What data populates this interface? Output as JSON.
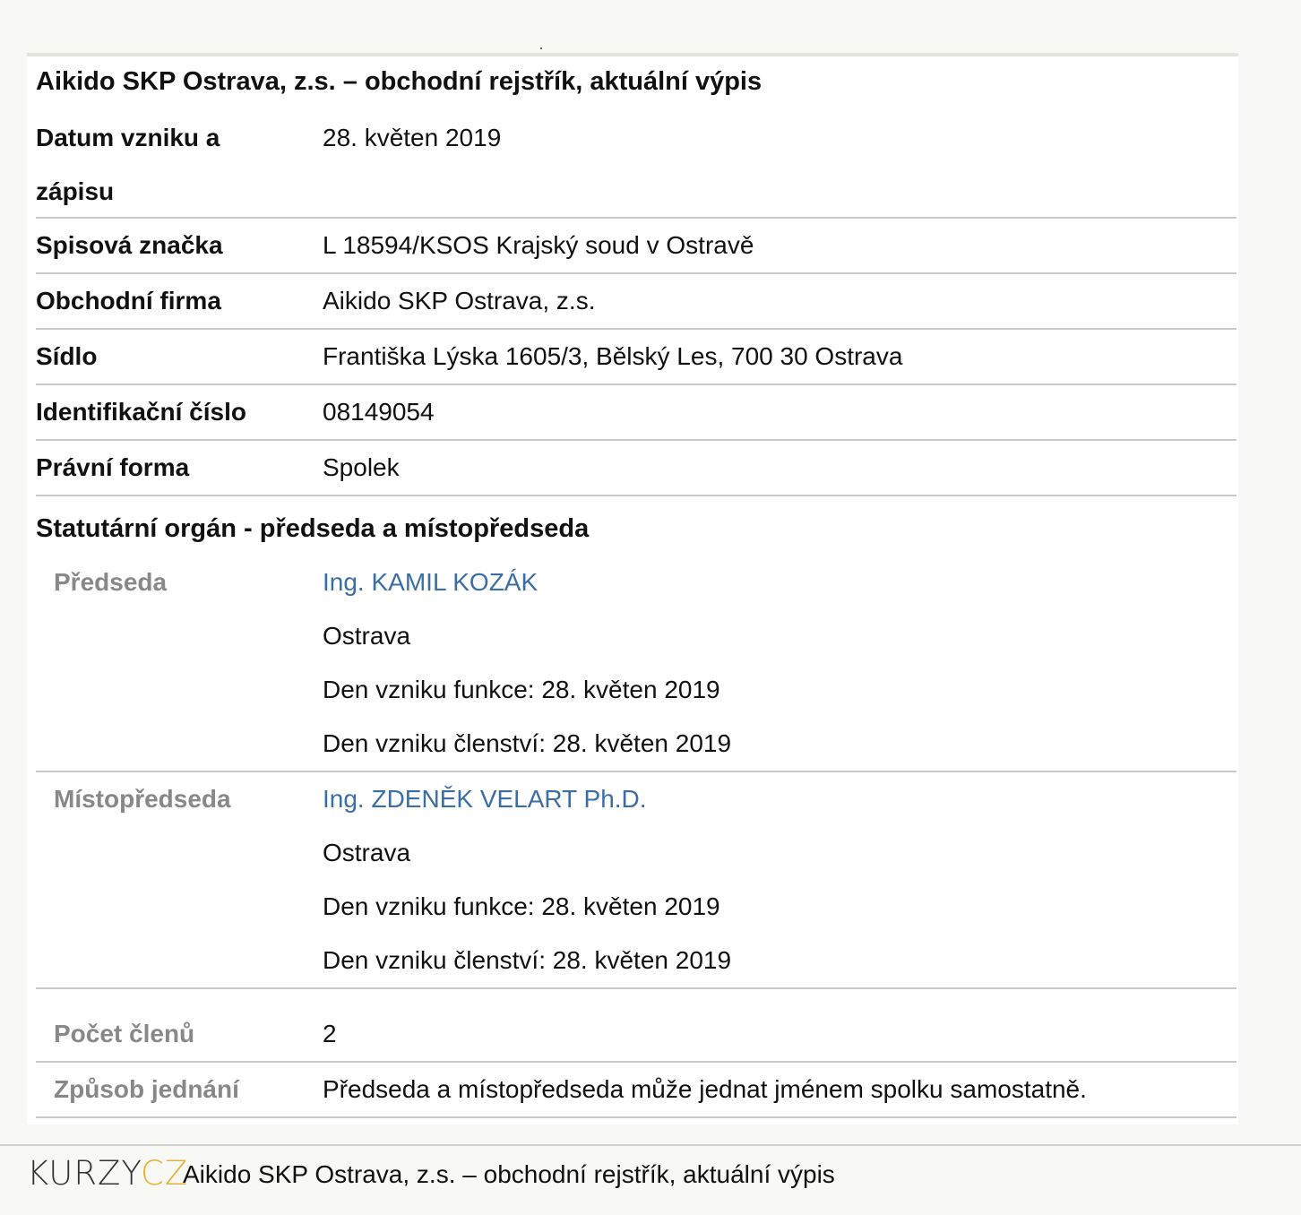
{
  "document": {
    "title": "Aikido SKP Ostrava, z.s. – obchodní rejstřík, aktuální výpis"
  },
  "fields": {
    "datum_label": "Datum vzniku a zápisu",
    "datum_value": "28. květen 2019",
    "spisova_label": "Spisová značka",
    "spisova_value": "L 18594/KSOS Krajský soud v Ostravě",
    "firma_label": "Obchodní firma",
    "firma_value": "Aikido SKP Ostrava, z.s.",
    "sidlo_label": "Sídlo",
    "sidlo_value": "Františka Lýska 1605/3, Bělský Les, 700 30 Ostrava",
    "ico_label": "Identifikační číslo",
    "ico_value": "08149054",
    "pravni_label": "Právní forma",
    "pravni_value": "Spolek"
  },
  "statutory": {
    "section_title": "Statutární orgán - předseda a místopředseda",
    "members": [
      {
        "role": "Předseda",
        "name": "Ing. KAMIL KOZÁK",
        "city": "Ostrava",
        "function_start": "Den vzniku funkce: 28. květen 2019",
        "membership_start": "Den vzniku členství: 28. květen 2019"
      },
      {
        "role": "Místopředseda",
        "name": "Ing. ZDENĚK VELART Ph.D.",
        "city": "Ostrava",
        "function_start": "Den vzniku funkce: 28. květen 2019",
        "membership_start": "Den vzniku členství: 28. květen 2019"
      }
    ],
    "pocet_label": "Počet členů",
    "pocet_value": "2",
    "zpusob_label": "Způsob jednání",
    "zpusob_value": "Předseda a místopředseda může jednat jménem spolku samostatně."
  },
  "footer": {
    "logo_left": "KURZY",
    "logo_right": "CZ",
    "text": "Aikido SKP Ostrava, z.s. – obchodní rejstřík, aktuální výpis"
  },
  "colors": {
    "link": "#3a6ea5",
    "logo_accent": "#e3b23c",
    "sublabel": "#888888"
  }
}
